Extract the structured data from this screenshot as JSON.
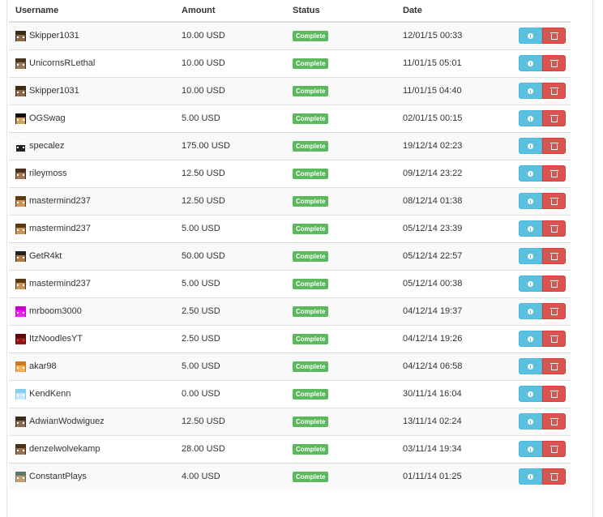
{
  "table": {
    "headers": {
      "username": "Username",
      "amount": "Amount",
      "status": "Status",
      "date": "Date"
    },
    "rows": [
      {
        "username": "Skipper1031",
        "amount": "10.00 USD",
        "status": "Complete",
        "date": "12/01/15 00:33",
        "avatar": {
          "hair": "#3b2a14",
          "skin": "#8a6a4a",
          "eyes": "#ffffff"
        }
      },
      {
        "username": "UnicornsRLethal",
        "amount": "10.00 USD",
        "status": "Complete",
        "date": "11/01/15 05:01",
        "avatar": {
          "hair": "#4a3520",
          "skin": "#9a7a5a",
          "eyes": "#ffffff"
        }
      },
      {
        "username": "Skipper1031",
        "amount": "10.00 USD",
        "status": "Complete",
        "date": "11/01/15 04:40",
        "avatar": {
          "hair": "#3b2a14",
          "skin": "#8a6a4a",
          "eyes": "#ffffff"
        }
      },
      {
        "username": "OGSwag",
        "amount": "5.00 USD",
        "status": "Complete",
        "date": "02/01/15 00:15",
        "avatar": {
          "hair": "#111111",
          "skin": "#d6a25a",
          "eyes": "#ffffff"
        }
      },
      {
        "username": "specalez",
        "amount": "175.00 USD",
        "status": "Complete",
        "date": "19/12/14 02:23",
        "avatar": {
          "hair": "#ffffff",
          "skin": "#222222",
          "eyes": "#ffffff"
        }
      },
      {
        "username": "rileymoss",
        "amount": "12.50 USD",
        "status": "Complete",
        "date": "09/12/14 23:22",
        "avatar": {
          "hair": "#4a3020",
          "skin": "#a07858",
          "eyes": "#ffffff"
        }
      },
      {
        "username": "mastermind237",
        "amount": "12.50 USD",
        "status": "Complete",
        "date": "08/12/14 01:38",
        "avatar": {
          "hair": "#5a3a10",
          "skin": "#c9955a",
          "eyes": "#ffffff"
        }
      },
      {
        "username": "mastermind237",
        "amount": "5.00 USD",
        "status": "Complete",
        "date": "05/12/14 23:39",
        "avatar": {
          "hair": "#5a3a10",
          "skin": "#c9955a",
          "eyes": "#ffffff"
        }
      },
      {
        "username": "GetR4kt",
        "amount": "50.00 USD",
        "status": "Complete",
        "date": "05/12/14 22:57",
        "avatar": {
          "hair": "#222222",
          "skin": "#b07a48",
          "eyes": "#ffffff"
        }
      },
      {
        "username": "mastermind237",
        "amount": "5.00 USD",
        "status": "Complete",
        "date": "05/12/14 00:38",
        "avatar": {
          "hair": "#5a3a10",
          "skin": "#c9955a",
          "eyes": "#ffffff"
        }
      },
      {
        "username": "mrboom3000",
        "amount": "2.50 USD",
        "status": "Complete",
        "date": "04/12/14 19:37",
        "avatar": {
          "hair": "#cc00cc",
          "skin": "#ee22ee",
          "eyes": "#ffffff"
        }
      },
      {
        "username": "ItzNoodlesYT",
        "amount": "2.50 USD",
        "status": "Complete",
        "date": "04/12/14 19:26",
        "avatar": {
          "hair": "#5a0a0a",
          "skin": "#8a1a1a",
          "eyes": "#ff3333"
        }
      },
      {
        "username": "akar98",
        "amount": "5.00 USD",
        "status": "Complete",
        "date": "04/12/14 06:58",
        "avatar": {
          "hair": "#d07a20",
          "skin": "#f0b060",
          "eyes": "#ffffff"
        }
      },
      {
        "username": "KendKenn",
        "amount": "0.00 USD",
        "status": "Complete",
        "date": "30/11/14 16:04",
        "avatar": {
          "hair": "#88ccee",
          "skin": "#cce8f8",
          "eyes": "#ffffff"
        }
      },
      {
        "username": "AdwianWodwiguez",
        "amount": "12.50 USD",
        "status": "Complete",
        "date": "13/11/14 02:24",
        "avatar": {
          "hair": "#3a2a1a",
          "skin": "#8a6a50",
          "eyes": "#ffffff"
        }
      },
      {
        "username": "denzelwolvekamp",
        "amount": "28.00 USD",
        "status": "Complete",
        "date": "03/11/14 19:34",
        "avatar": {
          "hair": "#4a3018",
          "skin": "#9a7050",
          "eyes": "#ffffff"
        }
      },
      {
        "username": "ConstantPlays",
        "amount": "4.00 USD",
        "status": "Complete",
        "date": "01/11/14 01:25",
        "avatar": {
          "hair": "#5a7a6a",
          "skin": "#c0a070",
          "eyes": "#ffffff"
        }
      }
    ]
  },
  "colors": {
    "status_complete": "#5cb85c",
    "info_button": "#5bc0de",
    "delete_button": "#d9534f"
  }
}
